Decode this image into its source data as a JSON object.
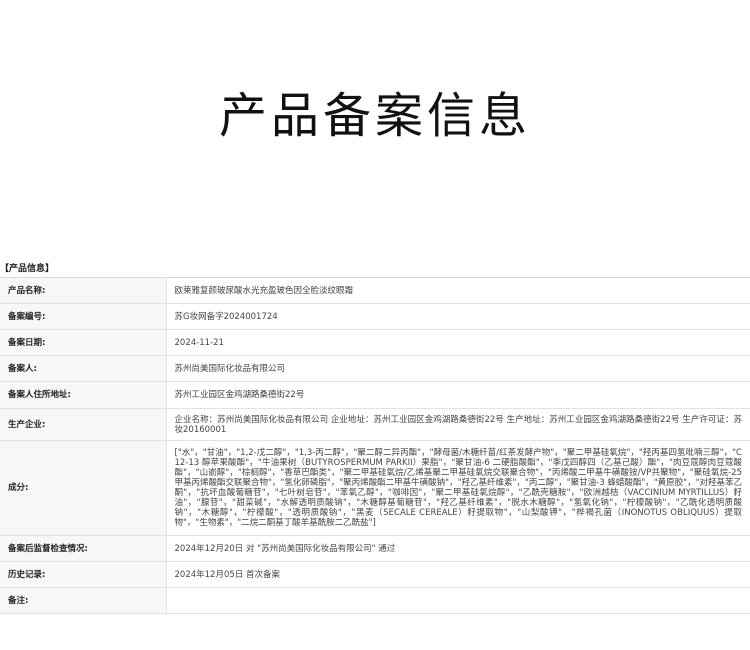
{
  "page_title": "产品备案信息",
  "section_header": "【产品信息】",
  "rows": [
    {
      "label": "产品名称:",
      "value": "欧莱雅复颜玻尿酸水光充盈玻色因全脸淡纹眼霜"
    },
    {
      "label": "备案编号:",
      "value": "苏G妆网备字2024001724"
    },
    {
      "label": "备案日期:",
      "value": "2024-11-21"
    },
    {
      "label": "备案人:",
      "value": "苏州尚美国际化妆品有限公司"
    },
    {
      "label": "备案人住所地址:",
      "value": "苏州工业园区金鸡湖路桑德街22号"
    },
    {
      "label": "生产企业:",
      "value": "企业名称：苏州尚美国际化妆品有限公司 企业地址：苏州工业园区金鸡湖路桑德街22号 生产地址：苏州工业园区金鸡湖路桑德街22号 生产许可证：苏妆20160001"
    },
    {
      "label": "成分:",
      "value": "[\"水\"，\"甘油\"，\"1,2-戊二醇\"，\"1,3-丙二醇\"，\"聚二醇二异丙酯\"，\"酵母菌/木糖纤苗/红茶发酵产物\"，\"聚二甲基硅氧烷\"，\"羟丙基四氢吡喃三醇\"，\"C12-13 醇苹果酸酯\"，\"牛油果树（BUTYROSPERMUM PARKII）果脂\"，\"聚甘油-6 二硬脂酸酯\"，\"季戊四醇四（乙基己酸）酯\"，\"肉豆蔻醇肉豆蔻酸酯\"，\"山嵛醇\"，\"棕榈醇\"，\"香草巴酯类\"，\"聚二甲基硅氧烷/乙烯基聚二甲基硅氧烷交联聚合物\"，\"丙烯酸二甲基牛磺酸铵/VP共聚物\"，\"聚硅氧烷-25 甲基丙烯酸酯交联聚合物\"，\"氢化卵磷脂\"，\"聚丙烯酸酯二甲基牛磺酸钠\"，\"羟乙基纤维素\"，\"丙二醇\"，\"聚甘油-3 蜂蜡酸酯\"，\"黄原胶\"，\"对羟基苯乙酮\"，\"抗坏血酸葡糖苷\"，\"七叶树皂苷\"，\"苯氧乙醇\"，\"咖啡因\"，\"聚二甲基硅氧烷醇\"，\"乙酰壳糖胺\"，\"欧洲越桔（VACCINIUM MYRTILLUS）籽油\"，\"腺苷\"，\"甜菜碱\"，\"水解透明质酸钠\"，\"木糖醇基葡糖苷\"，\"羟乙基纤维素\"，\"脱水木糖醇\"，\"氢氧化钠\"，\"柠檬酸钠\"，\"乙酰化透明质酸钠\"，\"木糖醇\"，\"柠檬酸\"，\"透明质酸钠\"，\"黑麦（SECALE CEREALE）籽提取物\"，\"山梨酸钾\"，\"桦褐孔菌（INONOTUS OBLIQUUS）提取物\"，\"生物素\"，\"二烷二酮基丁酸羊基酰胺二乙酰盐\"]"
    },
    {
      "label": "备案后监督检查情况:",
      "value": "2024年12月20日 对 \"苏州尚美国际化妆品有限公司\" 通过"
    },
    {
      "label": "历史记录:",
      "value": "2024年12月05日 首次备案"
    },
    {
      "label": "备注:",
      "value": ""
    }
  ]
}
